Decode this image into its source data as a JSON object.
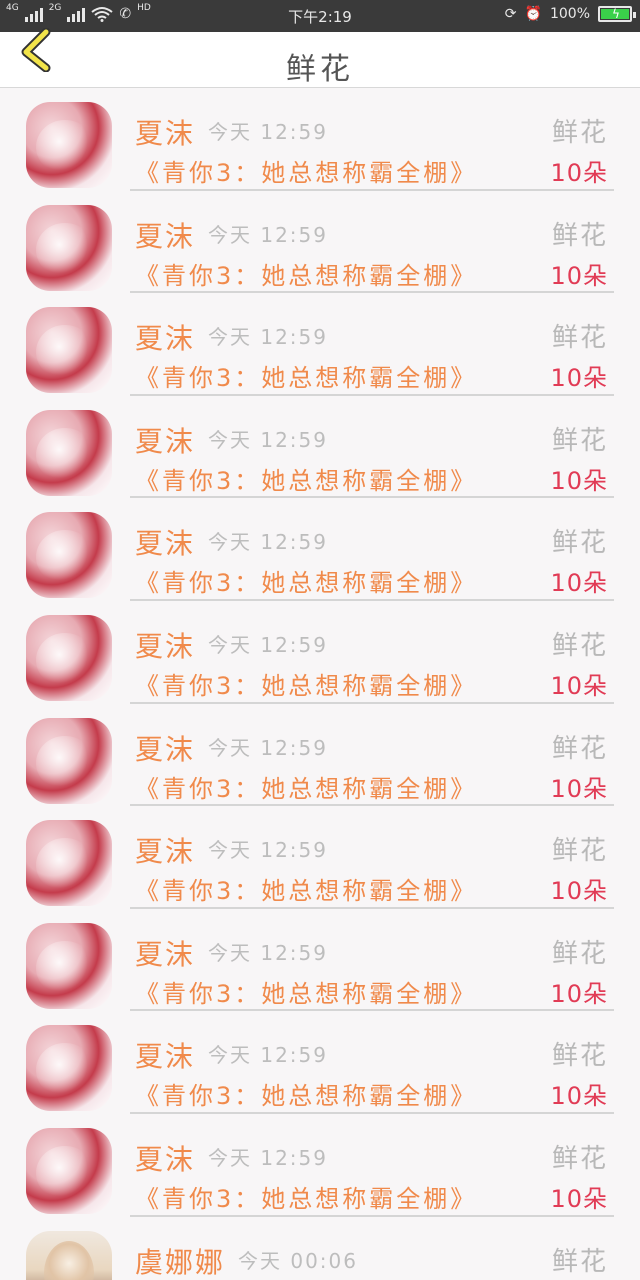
{
  "status": {
    "network_4g": "4G",
    "network_2g": "2G",
    "hd": "HD",
    "time": "下午2:19",
    "battery": "100%"
  },
  "header": {
    "title": "鲜花"
  },
  "items": [
    {
      "name": "夏沫",
      "time": "今天 12:59",
      "type": "鲜花",
      "book": "《青你3：她总想称霸全棚》",
      "amount": "10朵"
    },
    {
      "name": "夏沫",
      "time": "今天 12:59",
      "type": "鲜花",
      "book": "《青你3：她总想称霸全棚》",
      "amount": "10朵"
    },
    {
      "name": "夏沫",
      "time": "今天 12:59",
      "type": "鲜花",
      "book": "《青你3：她总想称霸全棚》",
      "amount": "10朵"
    },
    {
      "name": "夏沫",
      "time": "今天 12:59",
      "type": "鲜花",
      "book": "《青你3：她总想称霸全棚》",
      "amount": "10朵"
    },
    {
      "name": "夏沫",
      "time": "今天 12:59",
      "type": "鲜花",
      "book": "《青你3：她总想称霸全棚》",
      "amount": "10朵"
    },
    {
      "name": "夏沫",
      "time": "今天 12:59",
      "type": "鲜花",
      "book": "《青你3：她总想称霸全棚》",
      "amount": "10朵"
    },
    {
      "name": "夏沫",
      "time": "今天 12:59",
      "type": "鲜花",
      "book": "《青你3：她总想称霸全棚》",
      "amount": "10朵"
    },
    {
      "name": "夏沫",
      "time": "今天 12:59",
      "type": "鲜花",
      "book": "《青你3：她总想称霸全棚》",
      "amount": "10朵"
    },
    {
      "name": "夏沫",
      "time": "今天 12:59",
      "type": "鲜花",
      "book": "《青你3：她总想称霸全棚》",
      "amount": "10朵"
    },
    {
      "name": "夏沫",
      "time": "今天 12:59",
      "type": "鲜花",
      "book": "《青你3：她总想称霸全棚》",
      "amount": "10朵"
    },
    {
      "name": "夏沫",
      "time": "今天 12:59",
      "type": "鲜花",
      "book": "《青你3：她总想称霸全棚》",
      "amount": "10朵"
    }
  ],
  "last_item": {
    "name": "虞娜娜",
    "time": "今天 00:06",
    "type": "鲜花"
  }
}
